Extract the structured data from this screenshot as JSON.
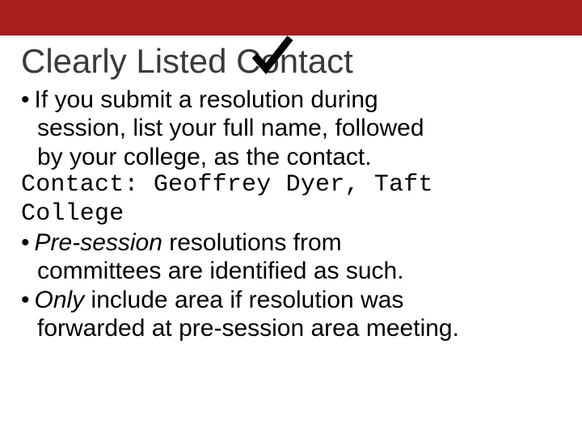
{
  "slide": {
    "title": "Clearly Listed Contact",
    "bullets": {
      "b1": {
        "line1": "If you submit a resolution during",
        "line2": "session, list your full name, followed",
        "line3": "by your college, as the contact."
      },
      "contact_line1": "Contact: Geoffrey Dyer, Taft",
      "contact_line2": "College",
      "b2": {
        "emph": "Pre-session",
        "rest1": " resolutions from",
        "line2": "committees are identified as such."
      },
      "b3": {
        "emph": "Only",
        "rest1": " include area if resolution was",
        "line2": "forwarded at pre-session area meeting."
      }
    }
  },
  "colors": {
    "accent": "#a81e1e"
  }
}
